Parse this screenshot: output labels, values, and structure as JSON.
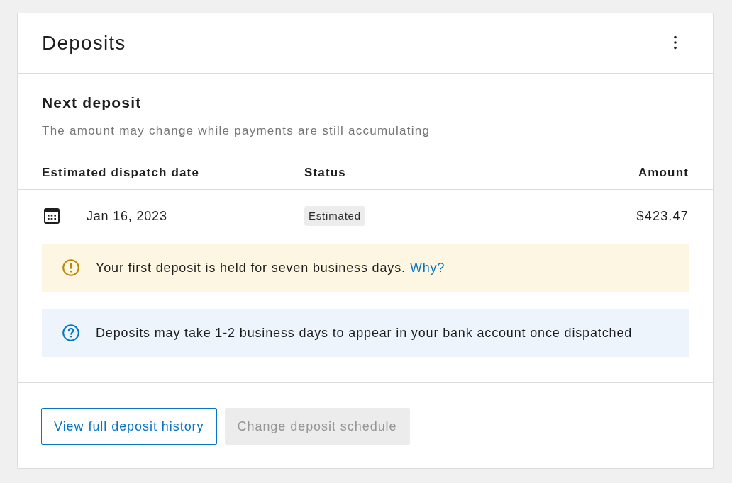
{
  "card": {
    "title": "Deposits"
  },
  "next_deposit": {
    "heading": "Next deposit",
    "description": "The amount may change while payments are still accumulating",
    "table": {
      "columns": [
        "Estimated dispatch date",
        "Status",
        "Amount"
      ],
      "rows": [
        {
          "date": "Jan 16, 2023",
          "status": "Estimated",
          "amount": "$423.47"
        }
      ]
    },
    "notices": [
      {
        "kind": "warning",
        "text": "Your first deposit is held for seven business days.",
        "link": "Why?"
      },
      {
        "kind": "info",
        "text": "Deposits may take 1-2 business days to appear in your bank account once dispatched"
      }
    ]
  },
  "buttons": [
    {
      "label": "View full deposit history",
      "disabled": false
    },
    {
      "label": "Change deposit schedule",
      "disabled": true
    }
  ]
}
